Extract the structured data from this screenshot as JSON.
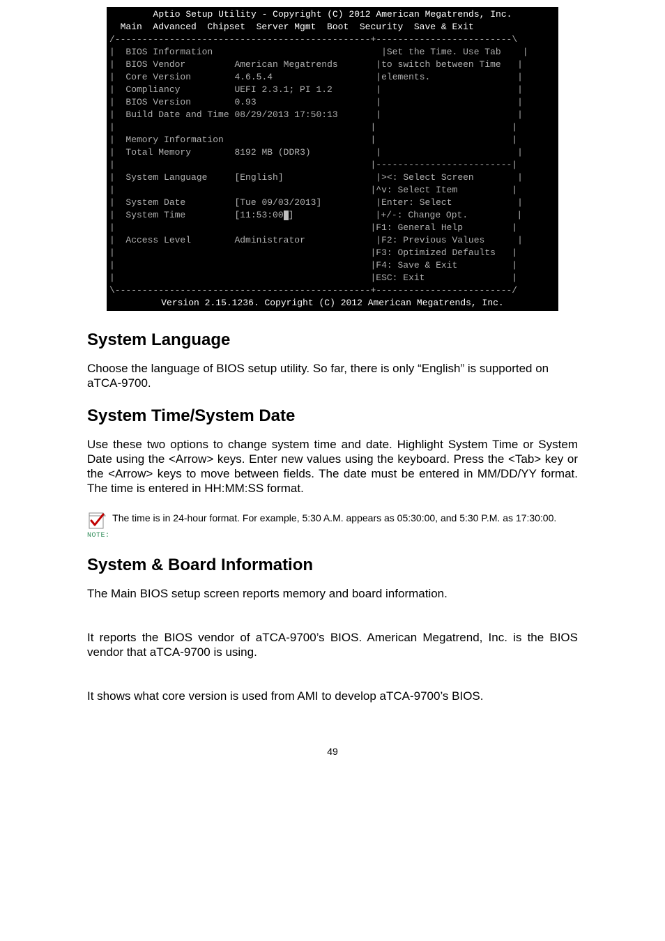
{
  "bios": {
    "title_line": "Aptio Setup Utility - Copyright (C) 2012 American Megatrends, Inc.",
    "menubar": "  Main  Advanced  Chipset  Server Mgmt  Boot  Security  Save & Exit",
    "rows_left": {
      "section1_title": "BIOS Information",
      "vendor_label": "BIOS Vendor",
      "vendor_value": "American Megatrends",
      "core_label": "Core Version",
      "core_value": "4.6.5.4",
      "compliancy_label": "Compliancy",
      "compliancy_value": "UEFI 2.3.1; PI 1.2",
      "biosver_label": "BIOS Version",
      "biosver_value": "0.93",
      "build_label": "Build Date and Time",
      "build_value": "08/29/2013 17:50:13",
      "mem_section": "Memory Information",
      "totalmem_label": "Total Memory",
      "totalmem_value": "8192 MB (DDR3)",
      "lang_label": "System Language",
      "lang_value": "[English]",
      "date_label": "System Date",
      "date_value": "[Tue 09/03/2013]",
      "time_label": "System Time",
      "time_value": "[11:53:00",
      "time_close": "]",
      "access_label": "Access Level",
      "access_value": "Administrator"
    },
    "rows_right": {
      "help1": "Set the Time. Use Tab",
      "help2": "to switch between Time",
      "help3": "elements.",
      "k1": "><: Select Screen",
      "k2": "^v: Select Item",
      "k3": "Enter: Select",
      "k4": "+/-: Change Opt.",
      "k5": "F1: General Help",
      "k6": "F2: Previous Values",
      "k7": "F3: Optimized Defaults",
      "k8": "F4: Save & Exit",
      "k9": "ESC: Exit"
    },
    "footer": "Version 2.15.1236. Copyright (C) 2012 American Megatrends, Inc."
  },
  "doc": {
    "h_lang": "System Language",
    "p_lang": "Choose the language of BIOS setup utility. So far, there is only “English” is supported on aTCA-9700.",
    "h_time": "System Time/System Date",
    "p_time": "Use these two options to change system time and date. Highlight System Time or System Date using the <Arrow> keys. Enter new values using the keyboard. Press the <Tab> key or the <Arrow> keys to move between fields. The date must be entered in MM/DD/YY format. The time is entered in HH:MM:SS format.",
    "note_label": "NOTE:",
    "note_text": "  The time is in 24-hour format. For example, 5:30 A.M. appears as 05:30:00, and 5:30 P.M. as 17:30:00.",
    "h_board": "System & Board Information",
    "p_board1": "The Main BIOS setup screen reports memory and board information.",
    "p_board2": "It reports the BIOS vendor of aTCA-9700’s BIOS. American Megatrend, Inc. is the BIOS vendor that aTCA-9700 is using.",
    "p_board3": "It shows what core version is used from AMI to develop aTCA-9700’s BIOS.",
    "pagenum": "49"
  }
}
